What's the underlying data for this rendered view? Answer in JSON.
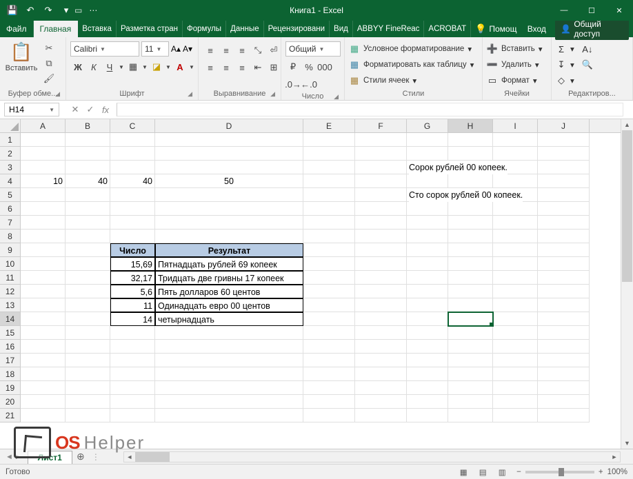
{
  "title": "Книга1 - Excel",
  "qat": {
    "save": "💾",
    "undo": "↶",
    "redo": "↷",
    "custom": "▾"
  },
  "winbuttons": {
    "min": "—",
    "max": "☐",
    "close": "✕"
  },
  "tabs": [
    "Файл",
    "Главная",
    "Вставка",
    "Разметка стран",
    "Формулы",
    "Данные",
    "Рецензировани",
    "Вид",
    "ABBYY FineReac",
    "ACROBAT"
  ],
  "help_label": "Помощ",
  "login_label": "Вход",
  "share_label": "Общий доступ",
  "ribbon": {
    "clipboard": {
      "paste": "Вставить",
      "label": "Буфер обме..."
    },
    "font": {
      "name": "Calibri",
      "size": "11",
      "label": "Шрифт"
    },
    "align": {
      "label": "Выравнивание"
    },
    "number": {
      "format": "Общий",
      "label": "Число"
    },
    "styles": {
      "cond": "Условное форматирование",
      "table": "Форматировать как таблицу",
      "cell": "Стили ячеек",
      "label": "Стили"
    },
    "cells": {
      "insert": "Вставить",
      "delete": "Удалить",
      "format": "Формат",
      "label": "Ячейки"
    },
    "edit": {
      "label": "Редактиров..."
    }
  },
  "namebox": "H14",
  "columns": [
    "A",
    "B",
    "C",
    "D",
    "E",
    "F",
    "G",
    "H",
    "I",
    "J"
  ],
  "rowcount": 21,
  "selected": {
    "row": 14,
    "col": "H"
  },
  "cells": {
    "r3": {
      "G": "Сорок рублей  00 копеек."
    },
    "r4": {
      "A": "10",
      "B": "40",
      "C": "40",
      "D": "50"
    },
    "r5": {
      "G": "Сто сорок рублей  00 копеек."
    },
    "r9": {
      "C": "Число",
      "D": "Результат"
    },
    "r10": {
      "C": "15,69",
      "D": "Пятнадцать рублей 69 копеек"
    },
    "r11": {
      "C": "32,17",
      "D": "Тридцать две гривны 17 копеек"
    },
    "r12": {
      "C": "5,6",
      "D": "Пять долларов 60 центов"
    },
    "r13": {
      "C": "11",
      "D": "Одинадцать евро 00 центов"
    },
    "r14": {
      "C": "14",
      "D": "четырнадцать"
    }
  },
  "sheet_tab": "Лист1",
  "status": "Готово",
  "zoom": "100%",
  "watermark": {
    "os": "OS",
    "helper": "Helper"
  }
}
